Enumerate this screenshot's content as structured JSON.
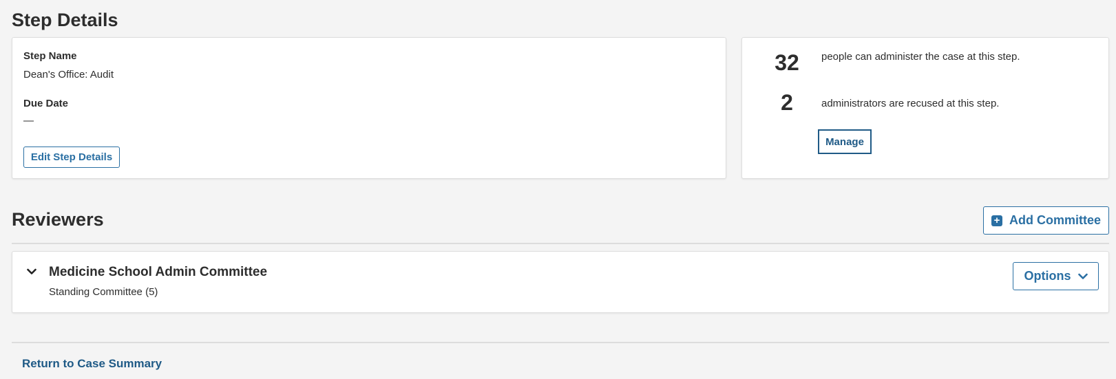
{
  "step_details": {
    "heading": "Step Details",
    "step_name_label": "Step Name",
    "step_name_value": "Dean's Office: Audit",
    "due_date_label": "Due Date",
    "due_date_value": "—",
    "edit_button_label": "Edit Step Details"
  },
  "stats": {
    "administer_count": "32",
    "administer_text": "people can administer the case at this step.",
    "recused_count": "2",
    "recused_text": "administrators are recused at this step.",
    "manage_label": "Manage"
  },
  "reviewers": {
    "heading": "Reviewers",
    "add_committee_label": "Add Committee",
    "committee": {
      "title": "Medicine School Admin Committee",
      "subtitle": "Standing Committee (5)",
      "options_label": "Options"
    }
  },
  "footer": {
    "return_link": "Return to Case Summary"
  },
  "colors": {
    "accent": "#2a6fa3",
    "link": "#1f5a86",
    "background": "#f4f4f4"
  },
  "icons": [
    "plus-square-icon",
    "chevron-down-icon"
  ]
}
